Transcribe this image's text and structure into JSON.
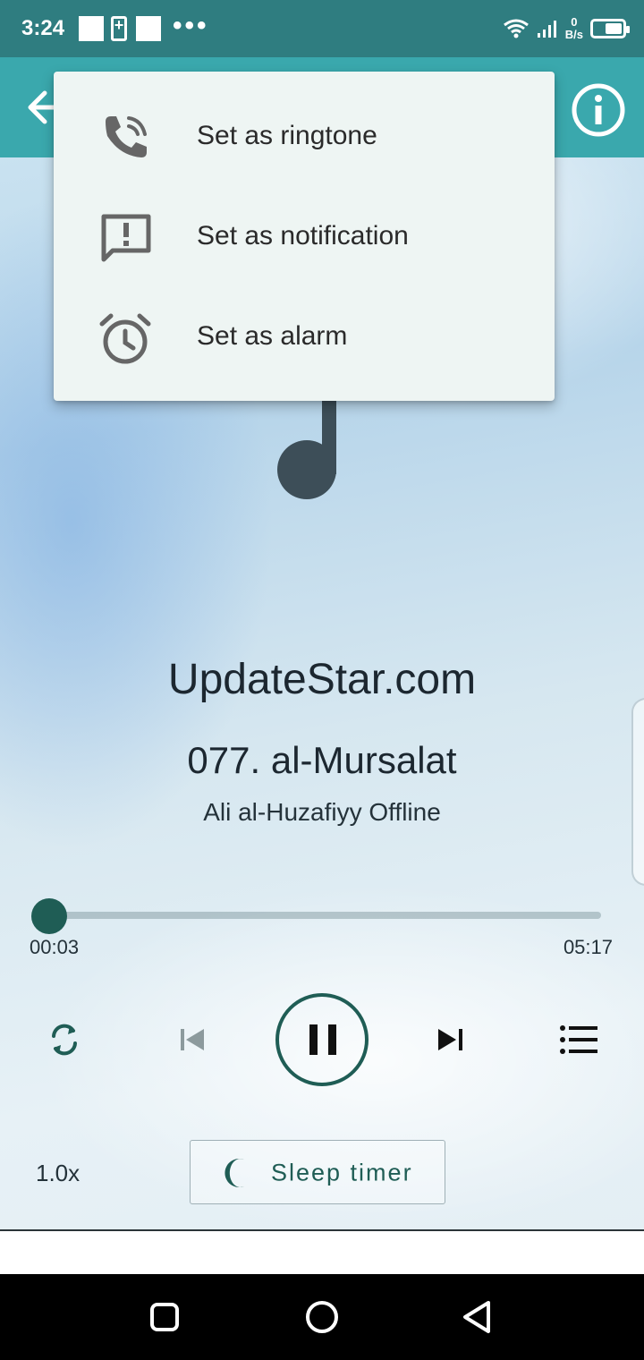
{
  "status_bar": {
    "time": "3:24",
    "net_speed_value": "0",
    "net_speed_unit": "B/s",
    "icons": [
      "notification-square-icon",
      "battery-saver-icon",
      "notification-square-icon",
      "more-dots-icon",
      "wifi-icon",
      "signal-icon",
      "battery-icon"
    ]
  },
  "app_bar": {
    "back_icon": "arrow-back-icon",
    "info_icon": "info-icon",
    "color": "#3aa8ad"
  },
  "menu": {
    "items": [
      {
        "label": "Set as ringtone",
        "icon": "phone-ringing-icon"
      },
      {
        "label": "Set as notification",
        "icon": "notification-alert-icon"
      },
      {
        "label": "Set as alarm",
        "icon": "alarm-clock-icon"
      }
    ]
  },
  "player": {
    "site": "UpdateStar.com",
    "track_title": "077. al-Mursalat",
    "subtitle": "Ali al-Huzafiyy Offline",
    "current_time": "00:03",
    "total_time": "05:17",
    "progress_fraction": 0.0095,
    "speed": "1.0x",
    "sleep_timer_label": "Sleep timer",
    "accent": "#1f5d55"
  },
  "nav_bar": {
    "buttons": [
      "recents-square-icon",
      "home-circle-icon",
      "back-triangle-icon"
    ]
  }
}
